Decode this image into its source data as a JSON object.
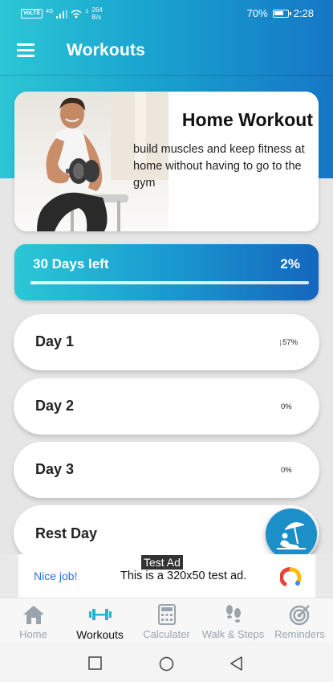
{
  "status_bar": {
    "network": "VoLTE",
    "signal_label": "4G",
    "net_speed_value": "264",
    "net_speed_unit": "B/s",
    "battery": "70%",
    "battery_level": 0.7,
    "time": "2:28"
  },
  "app_bar": {
    "title": "Workouts",
    "menu_icon": "hamburger-menu-icon"
  },
  "hero": {
    "title": "Home Workout",
    "description": "build muscles and keep fitness at home without having to go to the gym",
    "image": "man-lifting-dumbbell-photo"
  },
  "program_progress": {
    "days_left_label": "30 Days left",
    "percent_label": "2%",
    "percent": 0.02
  },
  "days": [
    {
      "label": "Day 1",
      "percent": "57%"
    },
    {
      "label": "Day 2",
      "percent": "0%"
    },
    {
      "label": "Day 3",
      "percent": "0%"
    },
    {
      "label": "Rest Day",
      "percent": ""
    }
  ],
  "fab": {
    "icon": "beach-umbrella-rest-icon"
  },
  "ad": {
    "tag": "Test Ad",
    "nice_job": "Nice job!",
    "text": "This is a 320x50 test ad.",
    "logo_icon": "admob-logo-icon"
  },
  "bottom_nav": {
    "active_index": 1,
    "items": [
      {
        "label": "Home",
        "icon": "home-icon"
      },
      {
        "label": "Workouts",
        "icon": "dumbbell-icon"
      },
      {
        "label": "Calculater",
        "icon": "calculator-icon"
      },
      {
        "label": "Walk & Steps",
        "icon": "footsteps-icon"
      },
      {
        "label": "Reminders",
        "icon": "target-icon"
      }
    ]
  },
  "colors": {
    "gradient_start": "#2cc6d6",
    "gradient_end": "#1466bd",
    "accent_link": "#2a72d8",
    "nav_inactive": "#9aa4ad",
    "nav_active_icon": "#22b7cc"
  }
}
